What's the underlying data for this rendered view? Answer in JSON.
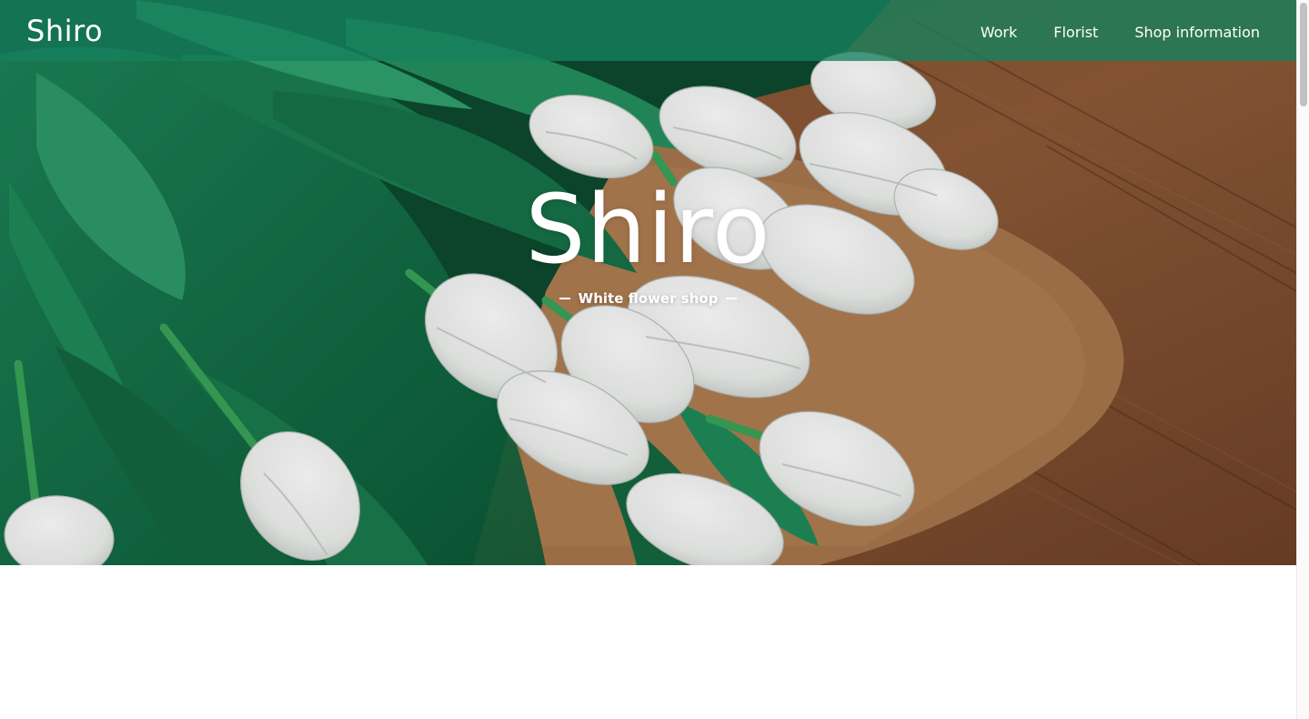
{
  "header": {
    "logo": "Shiro",
    "nav": [
      {
        "label": "Work"
      },
      {
        "label": "Florist"
      },
      {
        "label": "Shop information"
      }
    ]
  },
  "hero": {
    "title": "Shiro",
    "subtitle": "White flower shop",
    "image": "white tulip bouquet on kraft paper over wooden table"
  },
  "colors": {
    "header_bg": "#16805e",
    "text": "#ffffff",
    "page_bg": "#ffffff"
  }
}
